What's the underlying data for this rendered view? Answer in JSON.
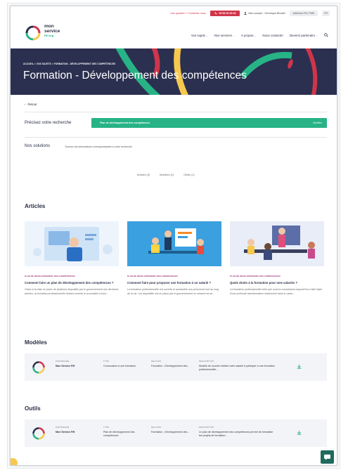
{
  "utility": {
    "question": "Une question ? Contactez-nous",
    "phone": "05 56 00 00 00",
    "account": "Mon compte : Véronique Blondel",
    "select": "Adhérent RH, PME",
    "lang": "FR"
  },
  "logo": {
    "line1": "mon",
    "line2": "service",
    "line3": "RH.org"
  },
  "nav": [
    "Vos sujets",
    "Nos services",
    "À propos",
    "Nous contacter",
    "Devenir partenaire"
  ],
  "banner": {
    "breadcrumb": "ACCUEIL > VOS SUJETS > FORMATION - DÉVELOPPEMENT DES COMPÉTENCES",
    "title": "Formation - Développement des compétences",
    "colors": {
      "bg": "#2b3050",
      "green": "#27b386",
      "red": "#d0354a",
      "yellow": "#f6c84e"
    }
  },
  "back_label": "Retour",
  "refine": {
    "label": "Précisez votre recherche",
    "value": "Plan de développement des compétences",
    "modify": "Modifier"
  },
  "solutions": {
    "label": "Nos solutions",
    "text": "Trouvez les informations correspondantes à votre recherche"
  },
  "tabs": [
    "Articles (3)",
    "Modèles (1)",
    "Outils (1)"
  ],
  "articles_title": "Articles",
  "articles": [
    {
      "tag": "PLAN DE DÉVELOPPEMENT DES COMPÉTENCES",
      "title": "Comment faire un plan de développement des compétences ?",
      "text": "Grâce à la mise en place de plusieurs dispositifs par le gouvernement ces dernières années, la formation professionnelle devient ouverte et accessible à tous..."
    },
    {
      "tag": "PLAN DE DÉVELOPPEMENT DES COMPÉTENCES",
      "title": "Comment faire pour proposer une formation à un salarié ?",
      "text": "La formation professionnelle est ouverte et accessible aux personnes tout au long de la vie. Les dispositifs mis en place par le gouvernement ne cessent de se..."
    },
    {
      "tag": "PLAN DE DÉVELOPPEMENT DES COMPÉTENCES",
      "title": "Quels droits à la formation pour mes salariés ?",
      "text": "La formation professionnelle telle que nous la connaissons aujourd'hui a fait l'objet d'une profonde transformation notamment dans le cadre..."
    }
  ],
  "modeles_title": "Modèles",
  "modele": {
    "partner_hd": "PARTENAIRE",
    "partner": "Mon Service RH",
    "type_hd": "TYPE",
    "type": "Convocation à une formation",
    "related_hd": "RELATED",
    "related": "Formation - Développement des...",
    "desc_hd": "DESCRIPTION",
    "desc": "Modèle de courrier invitant votre salarié à participer à une formation professionnelle..."
  },
  "outils_title": "Outils",
  "outil": {
    "partner_hd": "PARTENAIRE",
    "partner": "Mon Service RH",
    "type_hd": "TYPE",
    "type": "Plan de développement des compétences",
    "related_hd": "RELATED",
    "related": "Formation - Développement des...",
    "desc_hd": "DESCRIPTION",
    "desc": "Le plan de développement des compétences permet de formaliser les projets de formation..."
  }
}
